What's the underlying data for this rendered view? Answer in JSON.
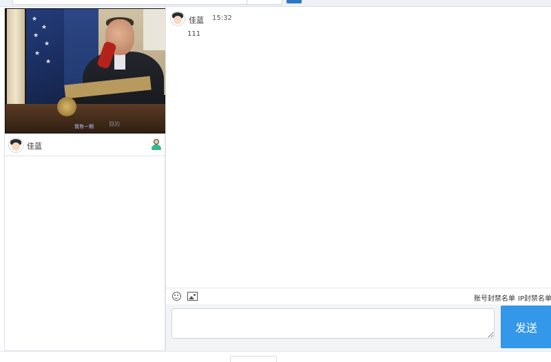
{
  "user": {
    "name": "佳蓝"
  },
  "video": {
    "caption": "我有一期",
    "watermark": "目的"
  },
  "messages": [
    {
      "name": "佳蓝",
      "time": "15:32",
      "text": "111"
    }
  ],
  "toolbar": {
    "emoji_icon": "smiley-icon",
    "image_icon": "image-icon",
    "account_blacklist": "账号封禁名单",
    "ip_blacklist": "IP封禁名单"
  },
  "composer": {
    "value": "",
    "placeholder": ""
  },
  "send_label": "发送",
  "colors": {
    "send_button": "#3397ea",
    "top_button": "#2a78c5"
  }
}
